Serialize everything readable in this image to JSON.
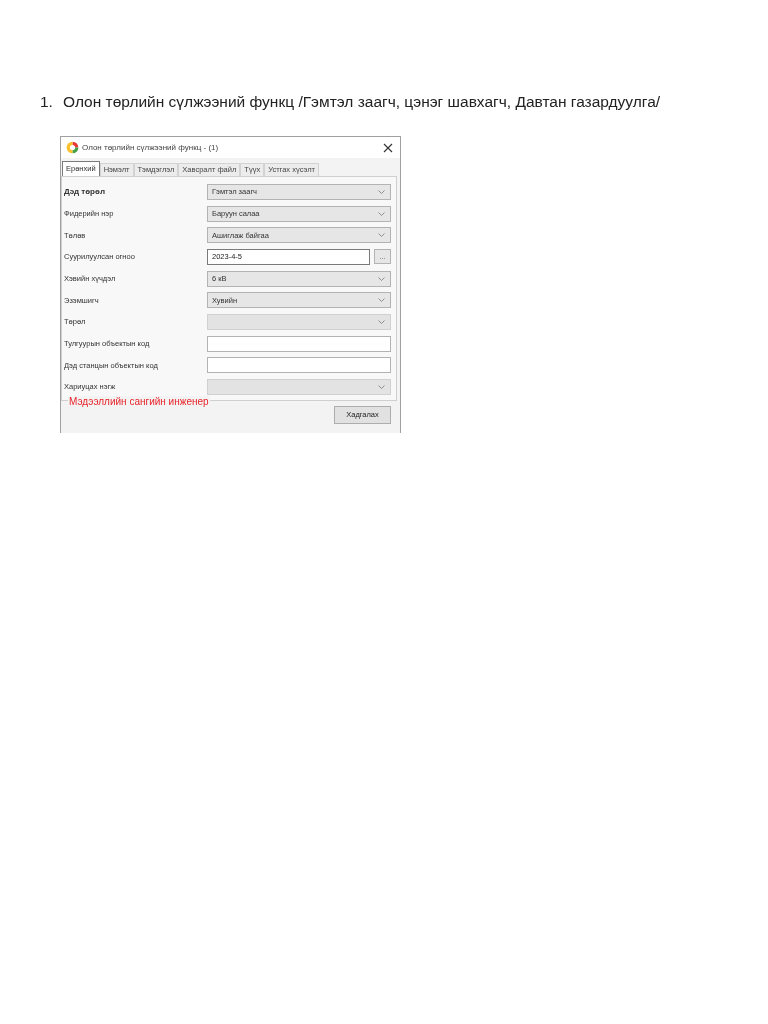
{
  "heading": {
    "number": "1.",
    "text": "Олон төрлийн сүлжээний функц /Гэмтэл заагч, цэнэг шавхагч, Давтан газардуулга/"
  },
  "dialog": {
    "title": "Олон төрлийн сүлжээний функц - (1)",
    "tabs": [
      {
        "label": "Ерөнхий",
        "selected": true
      },
      {
        "label": "Нэмэлт",
        "selected": false
      },
      {
        "label": "Тэмдэглэл",
        "selected": false
      },
      {
        "label": "Хавсралт файл",
        "selected": false
      },
      {
        "label": "Түүх",
        "selected": false
      },
      {
        "label": "Устгах хүсэлт",
        "selected": false
      }
    ],
    "fields": [
      {
        "label": "Дэд төрөл",
        "bold": true,
        "kind": "dropdown",
        "value": "Гэмтэл заагч",
        "disabled": false
      },
      {
        "label": "Фидерийн нэр",
        "bold": false,
        "kind": "dropdown",
        "value": "Баруун салаа",
        "disabled": false
      },
      {
        "label": "Төлөв",
        "bold": false,
        "kind": "dropdown",
        "value": "Ашиглаж байгаа",
        "disabled": false
      },
      {
        "label": "Суурилуулсан огноо",
        "bold": false,
        "kind": "date",
        "value": "2023-4-5",
        "picker": "..."
      },
      {
        "label": "Хэвийн хүчдэл",
        "bold": false,
        "kind": "dropdown",
        "value": "6 кВ",
        "disabled": false
      },
      {
        "label": "Эзэмшигч",
        "bold": false,
        "kind": "dropdown",
        "value": "Хувийн",
        "disabled": false
      },
      {
        "label": "Төрөл",
        "bold": false,
        "kind": "dropdown",
        "disabled": true
      },
      {
        "label": "Тулгуурын объектын код",
        "bold": false,
        "kind": "text"
      },
      {
        "label": "Дэд станцын объектын код",
        "bold": false,
        "kind": "text"
      },
      {
        "label": "Хариуцах нэгж",
        "bold": false,
        "kind": "dropdown",
        "disabled": true
      }
    ],
    "annotation": "Мэдээллийн сангийн инженер",
    "buttons": [
      "Хадгалах"
    ]
  }
}
